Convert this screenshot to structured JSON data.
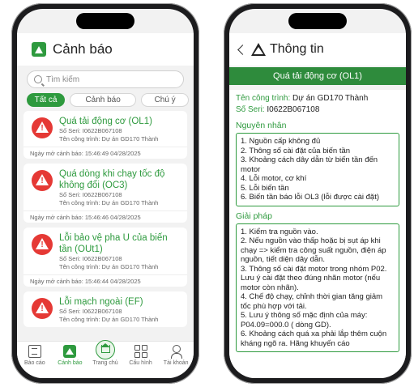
{
  "left": {
    "title": "Cảnh báo",
    "search_placeholder": "Tìm kiếm",
    "tabs": [
      "Tất cả",
      "Cảnh báo",
      "Chú ý"
    ],
    "alerts": [
      {
        "title": "Quá tải động cơ (OL1)",
        "serial": "Số Seri: I0622B067108",
        "project": "Tên công trình: Dự án GD170 Thành",
        "date": "Ngày mở cảnh báo: 15:46:49 04/28/2025"
      },
      {
        "title": "Quá dòng khi chạy tốc độ không đổi (OC3)",
        "serial": "Số Seri: I0622B067108",
        "project": "Tên công trình: Dự án GD170 Thành",
        "date": "Ngày mở cảnh báo: 15:46:46 04/28/2025"
      },
      {
        "title": "Lỗi bảo vệ pha U của biến tần (OUt1)",
        "serial": "Số Seri: I0622B067108",
        "project": "Tên công trình: Dự án GD170 Thành",
        "date": "Ngày mở cảnh báo: 15:46:44 04/28/2025"
      },
      {
        "title": "Lỗi mạch ngoài (EF)",
        "serial": "Số Seri: I0622B067108",
        "project": "Tên công trình: Dự án GD170 Thành",
        "date": ""
      }
    ],
    "nav": [
      "Báo cáo",
      "Cảnh báo",
      "Trang chủ",
      "Cấu hình",
      "Tài khoản"
    ]
  },
  "right": {
    "title": "Thông tin",
    "banner": "Quá tải động cơ (OL1)",
    "project_key": "Tên công trình:",
    "project_val": " Dự án GD170 Thành",
    "serial_key": "Số Seri:",
    "serial_val": " I0622B067108",
    "cause_title": "Nguyên nhân",
    "causes": [
      "1. Nguồn cấp không đủ",
      "2. Thông số cài đặt của biến tần",
      "3. Khoảng cách dây dẫn từ biến tần đến motor",
      "4. Lỗi motor, cơ khí",
      "5. Lỗi biến tần",
      "6. Biến tần báo lỗi OL3 (lỗi được cài đặt)"
    ],
    "solution_title": "Giải pháp",
    "solutions": [
      "1. Kiểm tra nguồn vào.",
      "2. Nếu nguồn vào thấp hoặc bị sụt áp khi chạy => kiểm tra công suất nguồn, điện áp nguồn, tiết diện dây dẫn.",
      "3. Thông số cài đặt motor trong nhóm P02. Lưu ý cài đặt theo đúng nhãn motor (nếu motor còn nhãn).",
      "4. Chế độ chạy, chỉnh thời gian tăng giảm tốc phù hợp với tải.",
      "5. Lưu ý thông số mặc định của máy: P04.09=000.0 ( dòng GD).",
      "6. Khoảng cách quá xa phải lắp thêm cuộn kháng ngõ ra. Hãng khuyến cáo"
    ]
  },
  "colors": {
    "accent": "#2e9a3e",
    "alert": "#e53935"
  }
}
